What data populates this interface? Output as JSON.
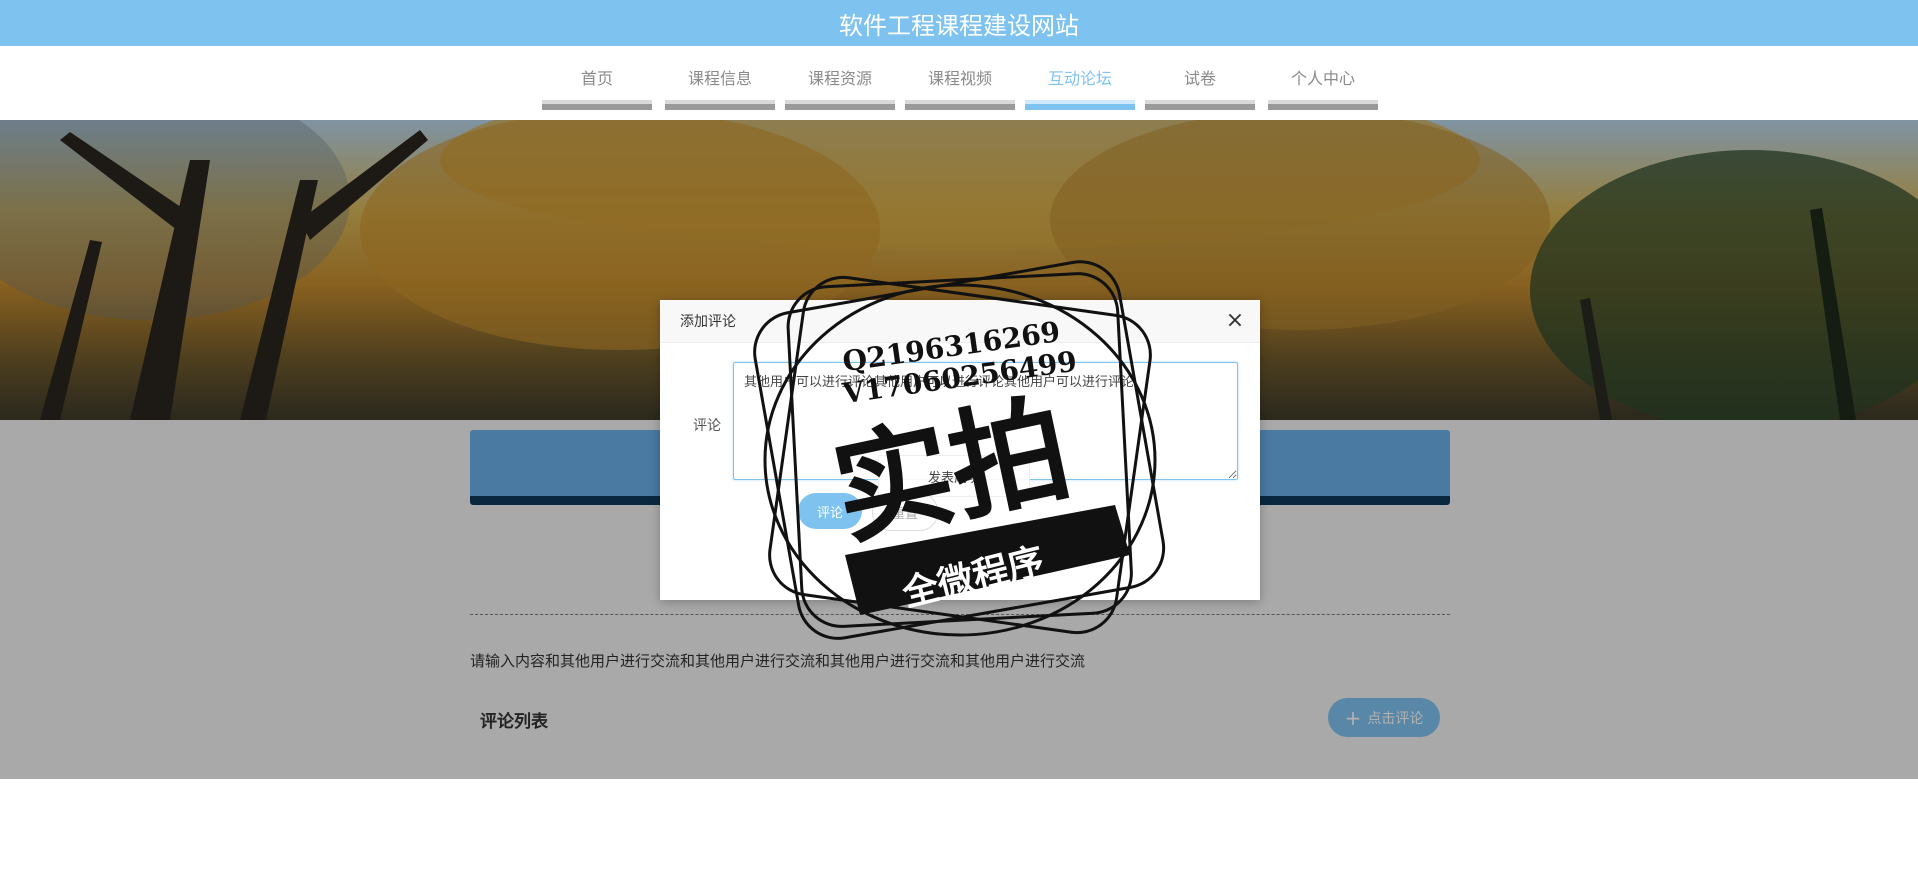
{
  "header": {
    "site_title": "软件工程课程建设网站"
  },
  "nav": {
    "items": [
      {
        "label": "首页"
      },
      {
        "label": "课程信息"
      },
      {
        "label": "课程资源"
      },
      {
        "label": "课程视频"
      },
      {
        "label": "互动论坛"
      },
      {
        "label": "试卷"
      },
      {
        "label": "个人中心"
      }
    ],
    "active": "互动论坛"
  },
  "forum": {
    "post_content": "请输入内容和其他用户进行交流和其他用户进行交流和其他用户进行交流和其他用户进行交流",
    "comment_list_title": "评论列表",
    "add_comment_label": "点击评论"
  },
  "dialog": {
    "title": "添加评论",
    "field_label": "评论",
    "textarea_value": "其他用户可以进行评论其他用户可以进行评论其他用户可以进行评论",
    "submit_label": "评论",
    "reset_label": "重置",
    "toast_text": "发表成功"
  },
  "watermark": {
    "contact_q": "Q2196316269",
    "contact_v": "V17060256499",
    "main_text": "实拍",
    "ribbon_text": "全微程序"
  },
  "colors": {
    "accent": "#7ec2f0",
    "panel_blue": "#6aaee8",
    "panel_dark": "#0e3a5c"
  }
}
